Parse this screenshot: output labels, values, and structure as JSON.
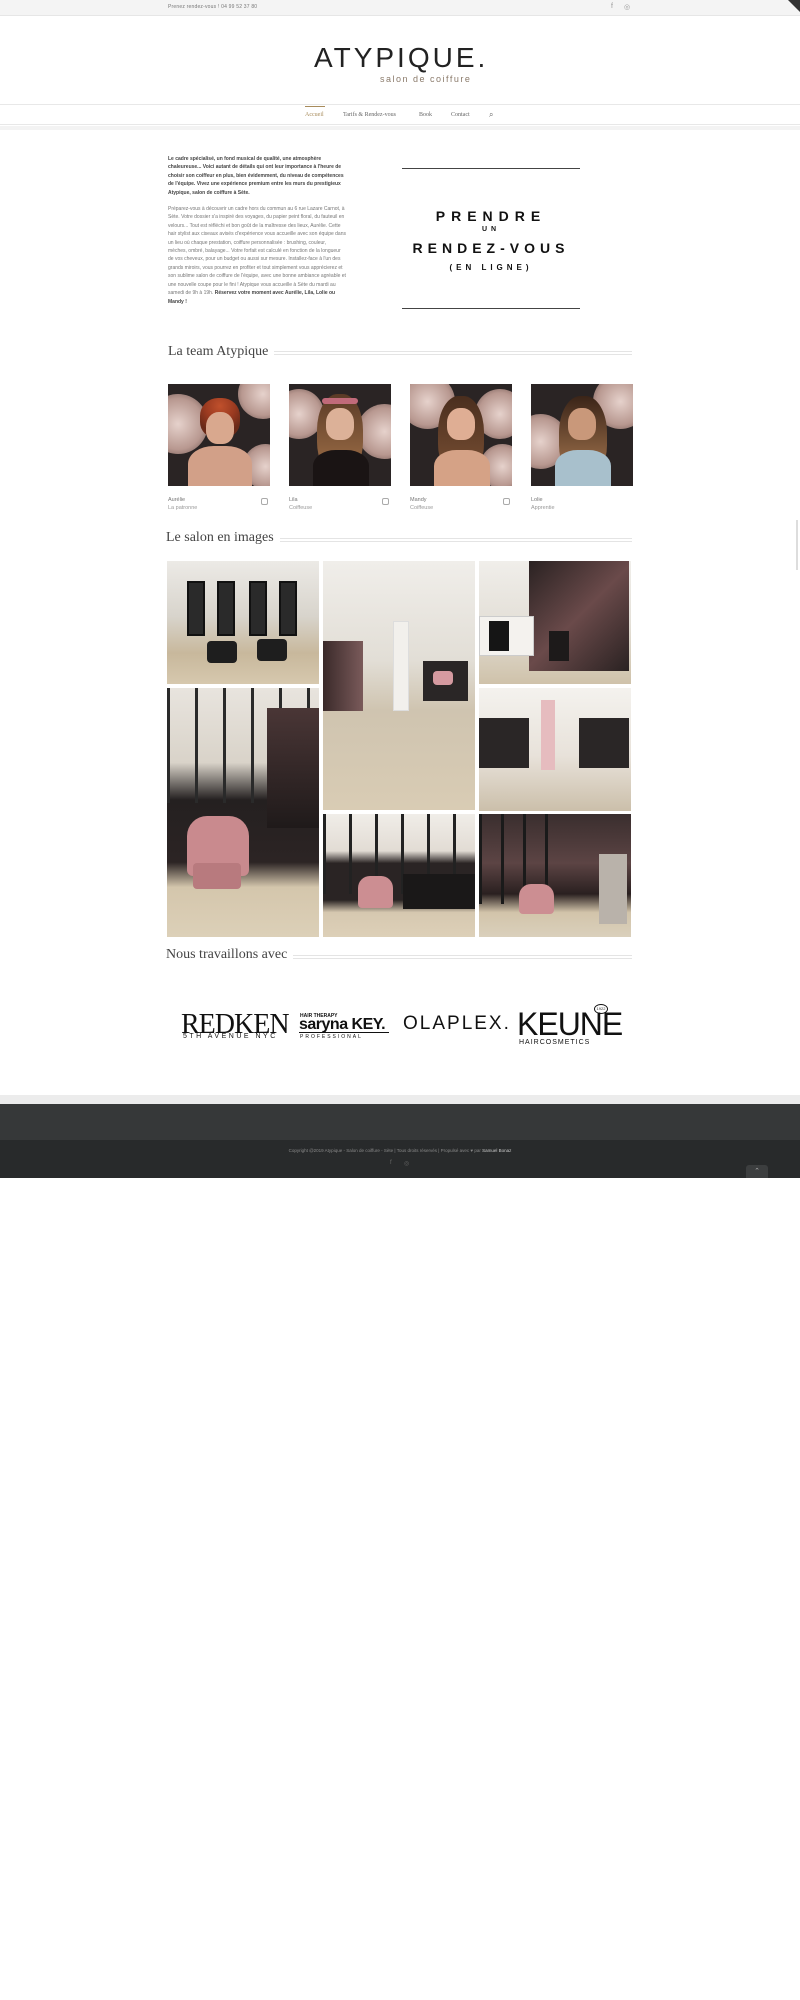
{
  "topbar": {
    "phone": "Prenez rendez-vous ! 04 99 52 37 80",
    "facebook_icon": "f",
    "instagram_icon": "◎"
  },
  "header": {
    "logo": "ATYPIQUE.",
    "tagline": "salon de coiffure"
  },
  "nav": {
    "items": [
      {
        "label": "Accueil",
        "active": true
      },
      {
        "label": "Tarifs & Rendez-vous"
      },
      {
        "label": "Book"
      },
      {
        "label": "Contact"
      }
    ],
    "search_icon": "⌕"
  },
  "intro": {
    "bold_text": "Le cadre spécialisé, un fond musical de qualité, une atmosphère chaleureuse... Voici autant de détails qui ont leur importance à l'heure de choisir son coiffeur en plus, bien évidemment, du niveau de compétences de l'équipe. Vivez une expérience premium entre les murs du prestigieux Atypique, salon de coiffure à Sète.",
    "body_text": "Préparez-vous à découvrir un cadre hors du commun au 6 rue Lazare Carnot, à Sète. Votre dossier s'a inspiré des voyages, du papier peint floral, du fauteuil en velours... Tout est réfléchi et bon goût de la maîtresse des lieux, Aurélie. Cette hair stylist aux ciseaux avisés d'expérience vous accueille avec son équipe dans un lieu où chaque prestation, coiffure personnalisée : brushing, couleur, mèches, ombré, balayage... Votre forfait est calculé en fonction de la longueur de vos cheveux, pour un budget ou aussi sur mesure. Installez-face à l'un des grands miroirs, vous pourrez en profiter et tout simplement vous apprécierez et son sublime salon de coiffure de l'équipe, avec une bonne ambiance agréable et une nouvelle coupe pour le fini ! Atypique vous accueille à Sète du mardi au samedi de 9h à 19h.",
    "closing_text": "Réservez votre moment avec Aurélie, Lila, Lolie ou Mandy !"
  },
  "appointment": {
    "line1": "PRENDRE",
    "line2": "UN",
    "line3": "RENDEZ-VOUS",
    "line4": "(EN LIGNE)"
  },
  "team": {
    "title": "La team Atypique",
    "members": [
      {
        "name": "Aurélie",
        "role": "La patronne"
      },
      {
        "name": "Lila",
        "role": "Coiffeuse"
      },
      {
        "name": "Mandy",
        "role": "Coiffeuse"
      },
      {
        "name": "Lolie",
        "role": "Apprentie"
      }
    ]
  },
  "gallery": {
    "title": "Le salon en images"
  },
  "partners": {
    "title": "Nous travaillons avec",
    "redken": "REDKEN",
    "redken_sub": "5TH AVENUE NYC",
    "key_top": "HAIR THERAPY",
    "key_main": "saryna KEY.",
    "key_sub": "PROFESSIONAL",
    "olaplex": "OLAPLEX.",
    "keune": "KEUNE",
    "keune_sub": "HAIRCOSMETICS",
    "keune_badge": "1922"
  },
  "footer": {
    "copyright": "Copyright @2019 Atypique - Salon de coiffure - Sète | Tous droits réservés | Propulsé avec ♥ par",
    "by": "Samuel Bonaz",
    "facebook_icon": "f",
    "instagram_icon": "◎",
    "to_top": "⌃"
  }
}
